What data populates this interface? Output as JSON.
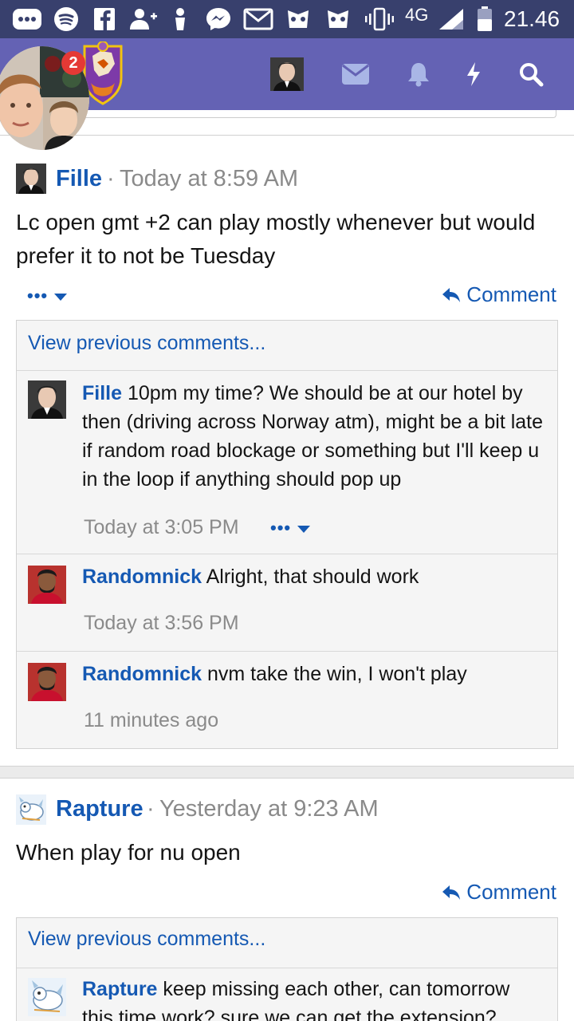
{
  "status_bar": {
    "network": "4G",
    "time": "21.46",
    "icons": [
      "more-icon",
      "spotify-icon",
      "facebook-icon",
      "add-friend-icon",
      "person-icon",
      "messenger-icon",
      "gmail-icon",
      "game-icon",
      "game-icon-2",
      "vibrate-icon",
      "signal-icon",
      "battery-icon"
    ]
  },
  "header": {
    "notification_count": "2",
    "icons": [
      "avatar-icon",
      "mail-icon",
      "bell-icon",
      "bolt-icon",
      "search-icon"
    ],
    "accent_color": "#6462b4",
    "status_color": "#38406d"
  },
  "posts": [
    {
      "author": "Fille",
      "separator": "·",
      "time": "Today at 8:59 AM",
      "body": "Lc open gmt +2 can play mostly whenever but would prefer it to not be Tuesday",
      "more_label": "•••",
      "comment_label": "Comment",
      "view_previous": "View previous comments...",
      "comments": [
        {
          "author": "Fille",
          "text": "10pm my time? We should be at our hotel by then (driving across Norway atm), might be a bit late if random road blockage or something but I'll keep u in the loop if anything should pop up",
          "time": "Today at 3:05 PM",
          "more_label": "•••"
        },
        {
          "author": "Randomnick",
          "text": "Alright, that should work",
          "time": "Today at 3:56 PM"
        },
        {
          "author": "Randomnick",
          "text": "nvm take the win, I won't play",
          "time": "11 minutes ago"
        }
      ]
    },
    {
      "author": "Rapture",
      "separator": "·",
      "time": "Yesterday at 9:23 AM",
      "body": "When play for nu open",
      "comment_label": "Comment",
      "view_previous": "View previous comments...",
      "comments": [
        {
          "author": "Rapture",
          "text": "keep missing each other, can tomorrow this time work? sure we can get the extension?"
        }
      ]
    }
  ],
  "link_color": "#1559b3"
}
